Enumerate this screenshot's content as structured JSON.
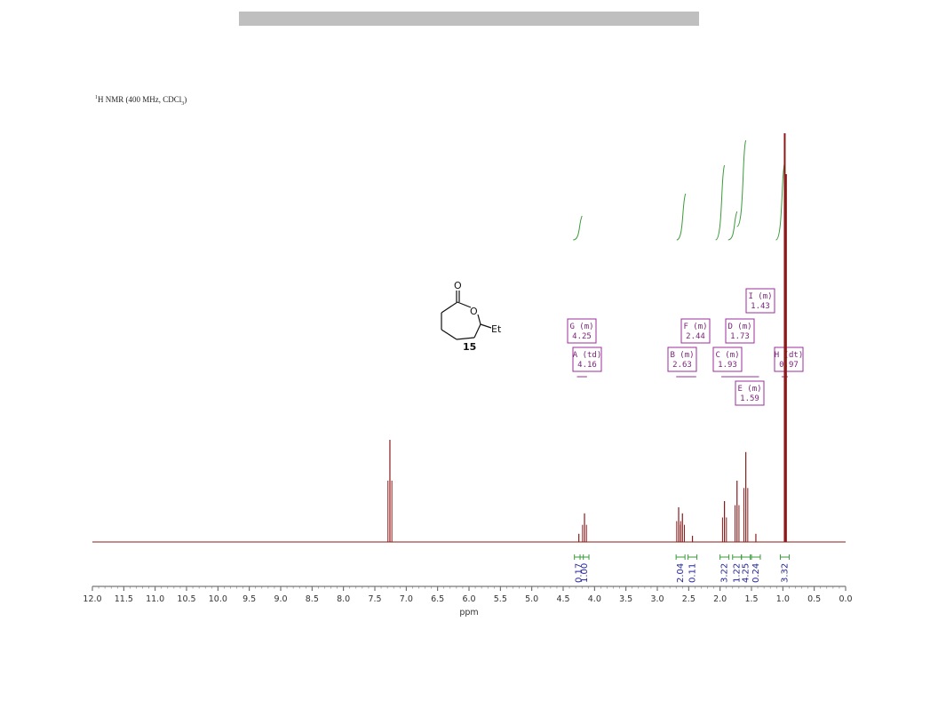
{
  "header": {
    "title_sup": "1",
    "title_main": "H NMR (400 MHz, CDCl",
    "title_sub": "3",
    "title_end": ")"
  },
  "molecule": {
    "carbonyl_oxygen": "O",
    "ring_oxygen": "O",
    "substituent": "Et",
    "compound_number": "15"
  },
  "colors": {
    "spectrum": "#8b1a1a",
    "integral_curve": "#3a9a3a",
    "multiplet_label": "#9b2f9b",
    "integral_value": "#26269a"
  },
  "chart_data": {
    "type": "line",
    "title": "1H NMR (400 MHz, CDCl3)",
    "xlabel": "ppm",
    "ylabel": "",
    "xlim": [
      12.0,
      0.0
    ],
    "x_reversed": true,
    "grid": false,
    "x_ticks": [
      "12.0",
      "11.5",
      "11.0",
      "10.5",
      "10.0",
      "9.5",
      "9.0",
      "8.5",
      "8.0",
      "7.5",
      "7.0",
      "6.5",
      "6.0",
      "5.5",
      "5.0",
      "4.5",
      "4.0",
      "3.5",
      "3.0",
      "2.5",
      "2.0",
      "1.5",
      "1.0",
      "0.5",
      "0.0"
    ],
    "peaks": [
      {
        "ppm": 7.26,
        "intensity": 0.25
      },
      {
        "ppm": 4.25,
        "intensity": 0.02
      },
      {
        "ppm": 4.16,
        "intensity": 0.07
      },
      {
        "ppm": 2.66,
        "intensity": 0.085
      },
      {
        "ppm": 2.6,
        "intensity": 0.07
      },
      {
        "ppm": 2.44,
        "intensity": 0.015
      },
      {
        "ppm": 1.93,
        "intensity": 0.1
      },
      {
        "ppm": 1.73,
        "intensity": 0.15
      },
      {
        "ppm": 1.59,
        "intensity": 0.22
      },
      {
        "ppm": 1.43,
        "intensity": 0.02
      },
      {
        "ppm": 0.97,
        "intensity": 1.0
      },
      {
        "ppm": 0.95,
        "intensity": 0.9
      }
    ],
    "multiplets": [
      {
        "label": "G (m)",
        "shift": "4.25"
      },
      {
        "label": "A (td)",
        "shift": "4.16"
      },
      {
        "label": "F (m)",
        "shift": "2.44"
      },
      {
        "label": "B (m)",
        "shift": "2.63"
      },
      {
        "label": "D (m)",
        "shift": "1.73"
      },
      {
        "label": "C (m)",
        "shift": "1.93"
      },
      {
        "label": "I (m)",
        "shift": "1.43"
      },
      {
        "label": "E (m)",
        "shift": "1.59"
      },
      {
        "label": "H (dt)",
        "shift": "0.97"
      }
    ],
    "integrals": [
      {
        "ppm": 4.25,
        "value": "0.17"
      },
      {
        "ppm": 4.16,
        "value": "1.00"
      },
      {
        "ppm": 2.63,
        "value": "2.04"
      },
      {
        "ppm": 2.44,
        "value": "0.11"
      },
      {
        "ppm": 1.93,
        "value": "3.22"
      },
      {
        "ppm": 1.73,
        "value": "1.22"
      },
      {
        "ppm": 1.59,
        "value": "4.25"
      },
      {
        "ppm": 1.43,
        "value": "0.24"
      },
      {
        "ppm": 0.97,
        "value": "3.32"
      }
    ]
  }
}
